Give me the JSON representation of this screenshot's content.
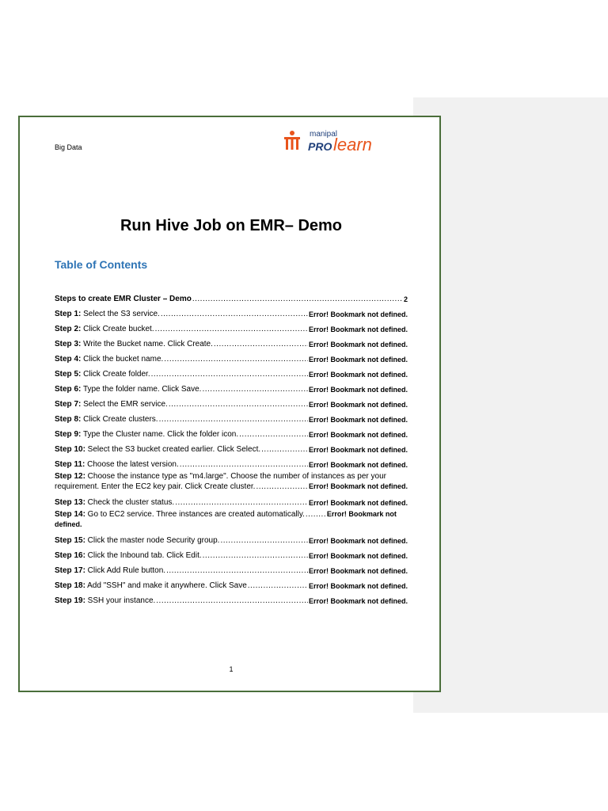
{
  "header": {
    "section": "Big Data",
    "logo_top": "manipal",
    "logo_pro": "PRO",
    "logo_learn": "learn"
  },
  "document": {
    "title": "Run Hive Job on EMR– Demo",
    "toc_heading": "Table of Contents",
    "page_number": "1"
  },
  "colors": {
    "border": "#4a6e3a",
    "toc_heading": "#2e74b5",
    "logo_orange": "#e8541c",
    "logo_blue": "#1f3f7a"
  },
  "toc": [
    {
      "step": "Steps to create EMR Cluster – Demo",
      "text": "",
      "ref": "2"
    },
    {
      "step": "Step 1:",
      "text": " Select the S3 service.",
      "ref": "Error! Bookmark not defined."
    },
    {
      "step": "Step 2:",
      "text": " Click Create bucket.",
      "ref": "Error! Bookmark not defined."
    },
    {
      "step": "Step 3:",
      "text": " Write the Bucket name. Click Create.",
      "ref": "Error! Bookmark not defined."
    },
    {
      "step": "Step 4:",
      "text": " Click the bucket name.",
      "ref": "Error! Bookmark not defined."
    },
    {
      "step": "Step 5:",
      "text": " Click Create folder.",
      "ref": "Error! Bookmark not defined."
    },
    {
      "step": "Step 6:",
      "text": " Type the folder name. Click Save.",
      "ref": "Error! Bookmark not defined."
    },
    {
      "step": "Step 7:",
      "text": " Select the EMR service.",
      "ref": "Error! Bookmark not defined."
    },
    {
      "step": "Step 8:",
      "text": " Click Create clusters.",
      "ref": "Error! Bookmark not defined."
    },
    {
      "step": "Step 9:",
      "text": " Type the Cluster name. Click the folder icon.",
      "ref": "Error! Bookmark not defined."
    },
    {
      "step": "Step 10:",
      "text": " Select the S3 bucket created earlier. Click Select.",
      "ref": "Error! Bookmark not defined."
    },
    {
      "step": "Step 11:",
      "text": " Choose the latest version.",
      "ref": "Error! Bookmark not defined."
    },
    {
      "step": "Step 12:",
      "text": " Choose the instance type as \"m4.large\". Choose the number of instances as per your",
      "text2": "requirement. Enter the EC2 key pair. Click Create cluster.",
      "ref": "Error! Bookmark not defined."
    },
    {
      "step": "Step 13:",
      "text": " Check the cluster status.",
      "ref": "Error! Bookmark not defined."
    },
    {
      "step": "Step 14:",
      "text": " Go to EC2 service. Three instances are created automatically.",
      "ref": "Error! Bookmark not",
      "ref2": "defined."
    },
    {
      "step": "Step 15:",
      "text": " Click the master node Security group.",
      "ref": "Error! Bookmark not defined."
    },
    {
      "step": "Step 16:",
      "text": " Click the Inbound tab. Click Edit.",
      "ref": "Error! Bookmark not defined."
    },
    {
      "step": "Step 17:",
      "text": " Click Add Rule button.",
      "ref": "Error! Bookmark not defined."
    },
    {
      "step": "Step 18:",
      "text": " Add \"SSH\" and make it anywhere. Click Save",
      "ref": "Error! Bookmark not defined."
    },
    {
      "step": "Step 19:",
      "text": " SSH your instance.",
      "ref": "Error! Bookmark not defined."
    }
  ]
}
